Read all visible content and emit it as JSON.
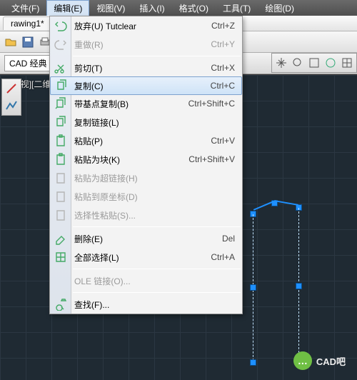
{
  "menubar": {
    "items": [
      "文件(F)",
      "编辑(E)",
      "视图(V)",
      "插入(I)",
      "格式(O)",
      "工具(T)",
      "绘图(D)"
    ],
    "activeIndex": 1
  },
  "tabs": {
    "active": "rawing1*"
  },
  "workspace": {
    "label": "CAD 经典"
  },
  "viewport": {
    "label": "-][俯视][二维"
  },
  "editMenu": {
    "items": [
      {
        "label": "放弃(U)  Tutclear",
        "shortcut": "Ctrl+Z",
        "icon": "undo-icon"
      },
      {
        "label": "重做(R)",
        "shortcut": "Ctrl+Y",
        "icon": "redo-icon",
        "disabled": true
      },
      {
        "sep": true
      },
      {
        "label": "剪切(T)",
        "shortcut": "Ctrl+X",
        "icon": "cut-icon"
      },
      {
        "label": "复制(C)",
        "shortcut": "Ctrl+C",
        "icon": "copy-icon",
        "highlight": true
      },
      {
        "label": "带基点复制(B)",
        "shortcut": "Ctrl+Shift+C",
        "icon": "copybase-icon"
      },
      {
        "label": "复制链接(L)",
        "icon": "copylink-icon"
      },
      {
        "label": "粘贴(P)",
        "shortcut": "Ctrl+V",
        "icon": "paste-icon"
      },
      {
        "label": "粘贴为块(K)",
        "shortcut": "Ctrl+Shift+V",
        "icon": "pasteblock-icon"
      },
      {
        "label": "粘贴为超链接(H)",
        "icon": "pastelink-icon",
        "disabled": true
      },
      {
        "label": "粘贴到原坐标(D)",
        "icon": "pasteorig-icon",
        "disabled": true
      },
      {
        "label": "选择性粘贴(S)...",
        "icon": "pastespecial-icon",
        "disabled": true
      },
      {
        "sep": true
      },
      {
        "label": "删除(E)",
        "shortcut": "Del",
        "icon": "erase-icon"
      },
      {
        "label": "全部选择(L)",
        "shortcut": "Ctrl+A",
        "icon": "selectall-icon"
      },
      {
        "sep": true
      },
      {
        "label": "OLE 链接(O)...",
        "disabled": true
      },
      {
        "sep": true
      },
      {
        "label": "查找(F)...",
        "icon": "find-icon"
      }
    ]
  },
  "watermark": {
    "text": "CAD吧",
    "bubble": "…"
  }
}
